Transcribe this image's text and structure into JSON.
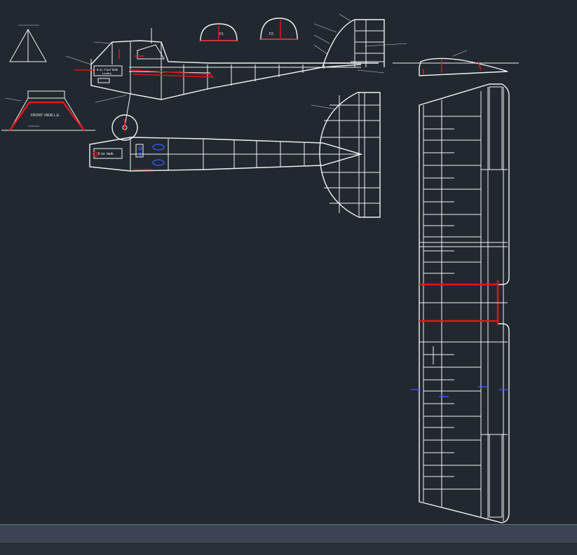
{
  "drawing": {
    "labels": {
      "front_view": "FRONT VIEW L.E.",
      "fuel_tank": "6 oz. Fuel Tank",
      "fuel_tank_sub": "Location",
      "fuel_tank_plan": "6 oz. tank",
      "former_f1": "F1",
      "former_f2": "F2"
    },
    "colors": {
      "background": "#212830",
      "linework": "#f2f2f2",
      "highlight": "#e01818",
      "markers": "#3b5bff"
    }
  },
  "command_line": {
    "value": "",
    "placeholder": ""
  }
}
